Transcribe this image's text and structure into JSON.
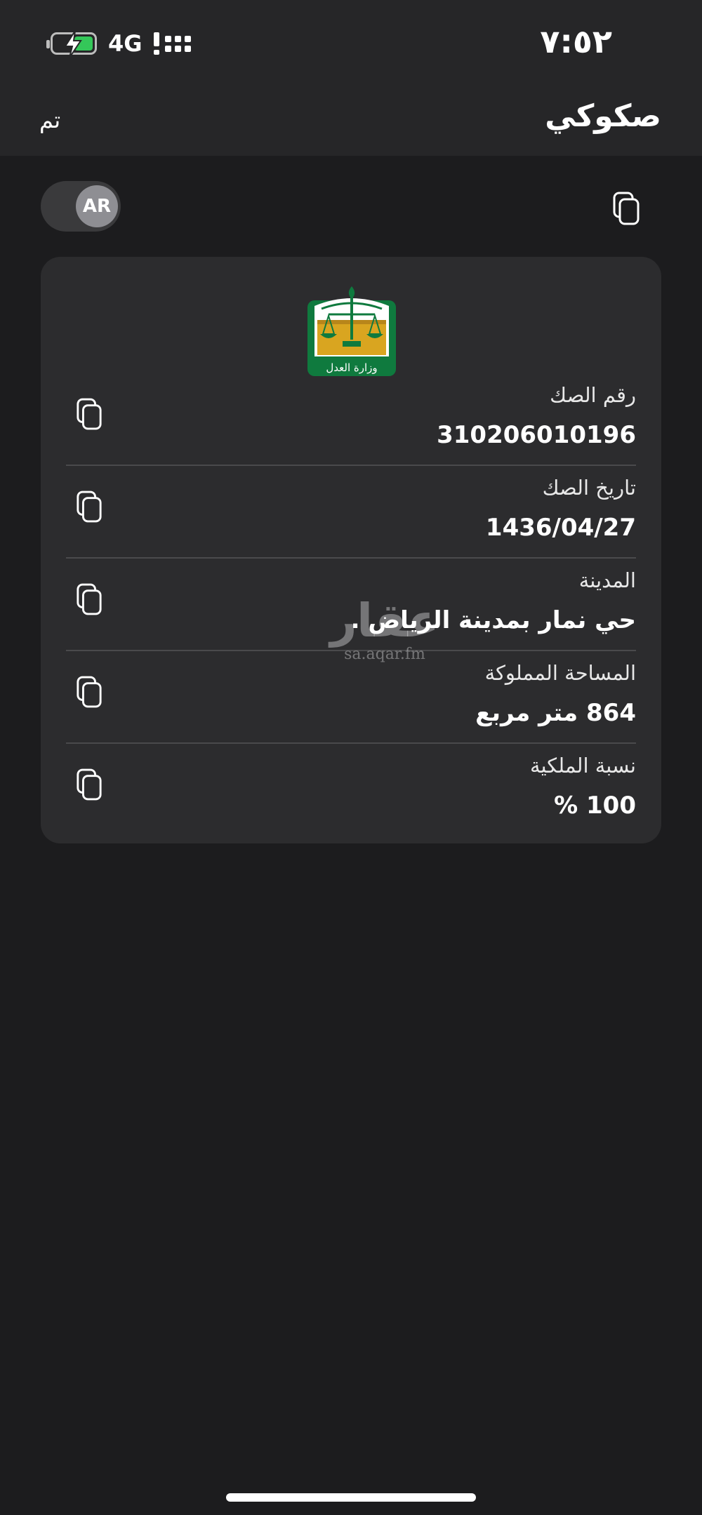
{
  "status_bar": {
    "time": "٧:٥٢",
    "network": "4G",
    "battery_color": "#34c759",
    "icons": [
      "battery-charging-icon",
      "cellular-signal-icon"
    ]
  },
  "nav": {
    "title": "صكوكي",
    "done_label": "تم"
  },
  "toolbar": {
    "language_toggle_label": "AR",
    "copy_all_icon": "copy-icon"
  },
  "deed": {
    "logo": "ministry-of-justice-logo",
    "logo_caption": "وزارة العدل",
    "fields": [
      {
        "label": "رقم الصك",
        "value": "310206010196"
      },
      {
        "label": "تاريخ الصك",
        "value": "1436/04/27"
      },
      {
        "label": "المدينة",
        "value": "حي  نمار  بمدينة الرياض ."
      },
      {
        "label": "المساحة المملوكة",
        "value": "864 متر مربع"
      },
      {
        "label": "نسبة الملكية",
        "value": "100 %"
      }
    ]
  },
  "watermark": {
    "main": "عقار",
    "sub": "sa.aqar.fm"
  },
  "colors": {
    "background": "#1c1c1e",
    "card": "#2c2c2e",
    "logo_green": "#0f7a3e",
    "logo_gold": "#d9a520"
  }
}
